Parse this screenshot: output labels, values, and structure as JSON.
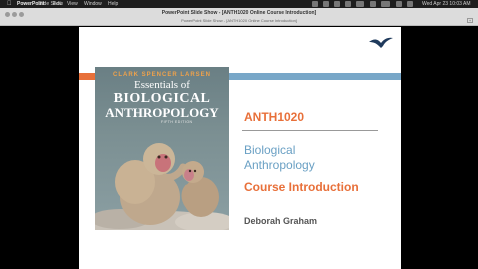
{
  "menubar": {
    "app_name": "PowerPoint",
    "menus": [
      "Slide Show",
      "Edit",
      "View",
      "Window",
      "Help"
    ],
    "clock": "Wed Apr 23  10:03 AM"
  },
  "window": {
    "title": "PowerPoint Slide Show - [ANTH1020 Online Course Introduction]",
    "tab_title": "PowerPoint Slide Show - [ANTH1020 Online Course Introduction]"
  },
  "slide": {
    "book_cover": {
      "author": "CLARK SPENCER LARSEN",
      "title_line1": "Essentials of",
      "title_line2": "BIOLOGICAL",
      "title_line3": "ANTHROPOLOGY",
      "edition": "FIFTH EDITION"
    },
    "course_code": "ANTH1020",
    "title_line1": "Biological",
    "title_line2": "Anthropology",
    "subtitle": "Course Introduction",
    "presenter": "Deborah Graham"
  },
  "colors": {
    "accent_orange": "#e8703a",
    "accent_blue": "#78a7c8",
    "title_blue": "#6aa0c4",
    "logo_navy": "#1f3a5c"
  }
}
